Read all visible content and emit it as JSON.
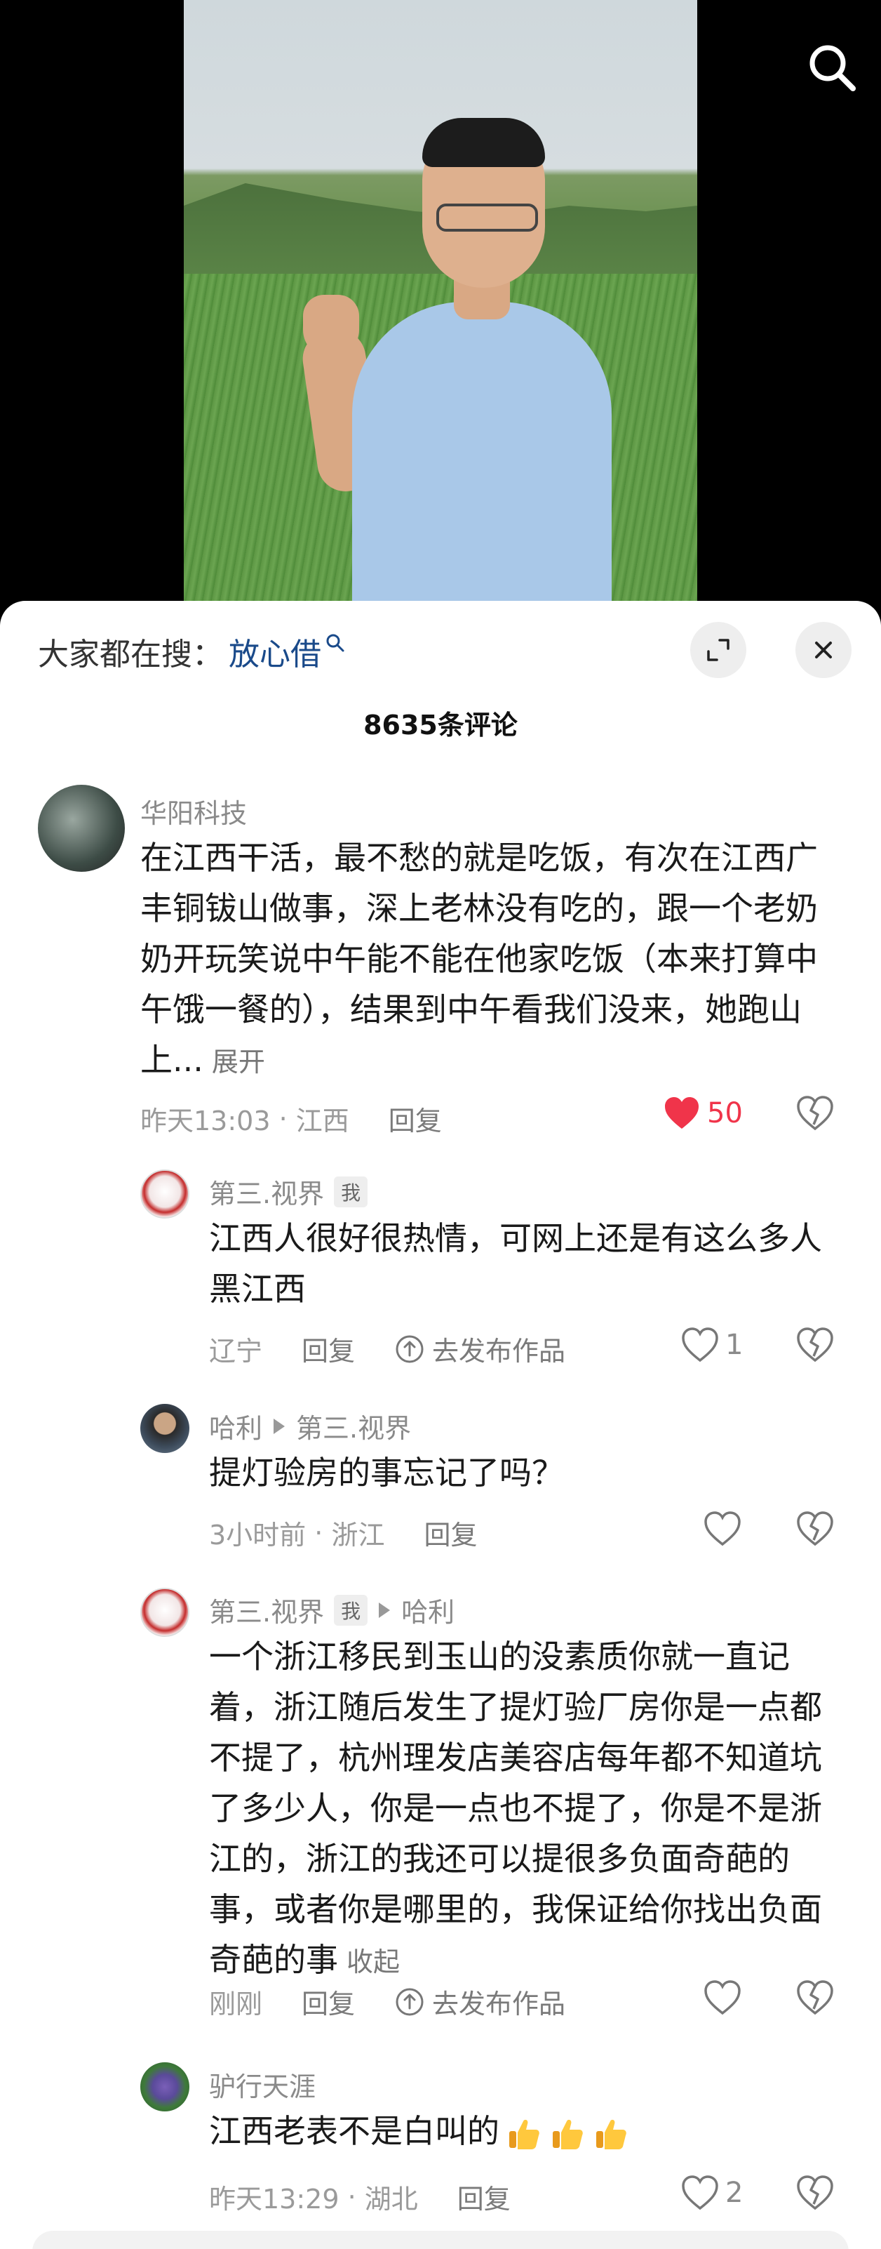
{
  "header": {
    "search_prefix": "大家都在搜：",
    "search_keyword": "放心借",
    "comment_count": "8635条评论"
  },
  "colors": {
    "like_active": "#f0344a",
    "keyword": "#1a4a8a"
  },
  "comments": [
    {
      "user": "华阳科技",
      "text": "在江西干活，最不愁的就是吃饭，有次在江西广丰铜钹山做事，深上老林没有吃的，跟一个老奶奶开玩笑说中午能不能在他家吃饭（本来打算中午饿一餐的），结果到中午看我们没来，她跑山上...",
      "expand": "展开",
      "time": "昨天13:03",
      "location": "江西",
      "reply": "回复",
      "likes": "50"
    },
    {
      "user": "第三.视界",
      "tag": "我",
      "text": "江西人很好很热情，可网上还是有这么多人黑江西",
      "location": "辽宁",
      "reply": "回复",
      "publish": "去发布作品",
      "likes": "1"
    },
    {
      "user": "哈利",
      "reply_to": "第三.视界",
      "text": "提灯验房的事忘记了吗？",
      "time": "3小时前",
      "location": "浙江",
      "reply": "回复"
    },
    {
      "user": "第三.视界",
      "tag": "我",
      "reply_to": "哈利",
      "text": "一个浙江移民到玉山的没素质你就一直记着，浙江随后发生了提灯验厂房你是一点都不提了，杭州理发店美容店每年都不知道坑了多少人，你是一点也不提了，你是不是浙江的，浙江的我还可以提很多负面奇葩的事，或者你是哪里的，我保证给你找出负面奇葩的事",
      "collapse": "收起",
      "time": "刚刚",
      "reply": "回复",
      "publish": "去发布作品"
    },
    {
      "user": "驴行天涯",
      "text": "江西老表不是白叫的",
      "time": "昨天13:29",
      "location": "湖北",
      "reply": "回复",
      "likes": "2"
    }
  ]
}
